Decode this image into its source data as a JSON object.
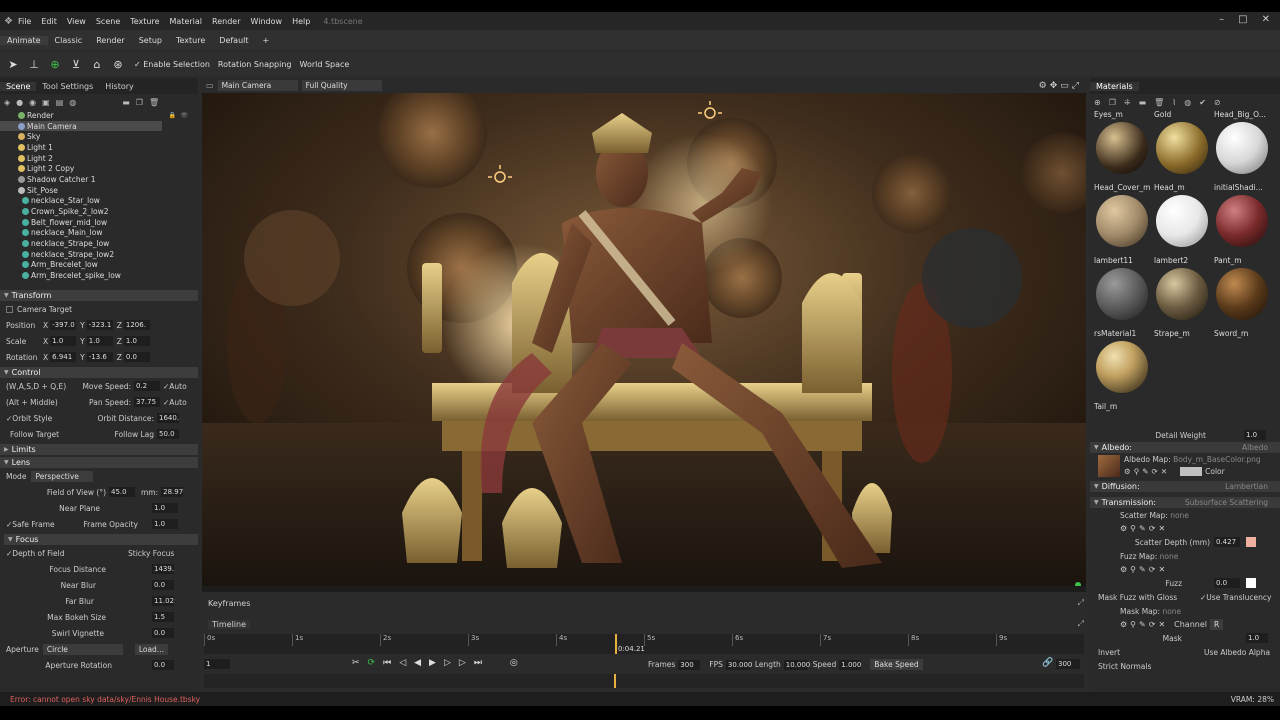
{
  "app": {
    "file_name": "4.tbscene"
  },
  "menu": [
    "File",
    "Edit",
    "View",
    "Scene",
    "Texture",
    "Material",
    "Render",
    "Window",
    "Help"
  ],
  "modes": [
    "Animate",
    "Classic",
    "Render",
    "Setup",
    "Texture",
    "Default",
    "+"
  ],
  "toolbar": {
    "enable_selection": "Enable Selection",
    "rotation_snapping": "Rotation Snapping",
    "world_space": "World Space"
  },
  "left_tabs": [
    "Scene",
    "Tool Settings",
    "History"
  ],
  "scene_tree": [
    "Render",
    "Main Camera",
    "Sky",
    "Light 1",
    "Light 2",
    "Light 2 Copy",
    "Shadow Catcher 1",
    "Sit_Pose",
    "necklace_Star_low",
    "Crown_Spike_2_low2",
    "Belt_flower_mid_low",
    "necklace_Main_low",
    "necklace_Strape_low",
    "necklace_Strape_low2",
    "Arm_Brecelet_low",
    "Arm_Brecelet_spike_low"
  ],
  "transform": {
    "title": "Transform",
    "camera_target": "Camera Target",
    "position": {
      "label": "Position",
      "x": "-397.0",
      "y": "-323.1",
      "z": "1206."
    },
    "scale": {
      "label": "Scale",
      "x": "1.0",
      "y": "1.0",
      "z": "1.0"
    },
    "rotation": {
      "label": "Rotation",
      "x": "6.941",
      "y": "-13.6",
      "z": "0.0"
    }
  },
  "control": {
    "title": "Control",
    "keys": "(W,A,S,D + Q,E)",
    "move_speed_label": "Move Speed:",
    "move_speed": "0.2",
    "auto": "Auto",
    "alt_middle": "(Alt + Middle)",
    "pan_speed_label": "Pan Speed:",
    "pan_speed": "37.75",
    "orbit_style": "Orbit Style",
    "orbit_distance_label": "Orbit Distance:",
    "orbit_distance": "1640.",
    "follow_target": "Follow Target",
    "follow_lag_label": "Follow Lag",
    "follow_lag": "50.0"
  },
  "limits": {
    "title": "Limits"
  },
  "lens": {
    "title": "Lens",
    "mode_label": "Mode",
    "mode": "Perspective",
    "fov_label": "Field of View (°)",
    "fov": "45.0",
    "mm_label": "mm:",
    "mm": "28.97",
    "near_plane_label": "Near Plane",
    "near_plane": "1.0",
    "safe_frame": "Safe Frame",
    "frame_opacity_label": "Frame Opacity",
    "frame_opacity": "1.0"
  },
  "focus": {
    "title": "Focus",
    "dof": "Depth of Field",
    "sticky": "Sticky Focus",
    "focus_distance_label": "Focus Distance",
    "focus_distance": "1439.",
    "near_blur_label": "Near Blur",
    "near_blur": "0.0",
    "far_blur_label": "Far Blur",
    "far_blur": "11.02",
    "max_bokeh_label": "Max Bokeh Size",
    "max_bokeh": "1.5",
    "swirl_label": "Swirl Vignette",
    "swirl": "0.0",
    "aperture_label": "Aperture",
    "aperture": "Circle",
    "load": "Load...",
    "aperture_rotation_label": "Aperture Rotation",
    "aperture_rotation": "0.0"
  },
  "viewport": {
    "camera": "Main Camera",
    "quality": "Full Quality"
  },
  "keyframes": {
    "label": "Keyframes"
  },
  "timeline": {
    "label": "Timeline",
    "ticks": [
      "0s",
      "1s",
      "2s",
      "3s",
      "4s",
      "5s",
      "6s",
      "7s",
      "8s",
      "9s"
    ],
    "current_time": "0:04.21",
    "current_frame": "1",
    "frames_label": "Frames",
    "frames": "300",
    "fps_label": "FPS",
    "fps": "30.000",
    "length_label": "Length",
    "length": "10.000",
    "speed_label": "Speed",
    "speed": "1.000",
    "bake_speed": "Bake Speed",
    "end_frame": "300"
  },
  "materials": {
    "title": "Materials",
    "top_labels": [
      "Eyes_m",
      "Gold",
      "Head_Big_O..."
    ],
    "items": [
      {
        "name": "Head_Cover_m",
        "color": "#3a2a1a"
      },
      {
        "name": "Head_m",
        "color": "#8a6a2a"
      },
      {
        "name": "initialShadi...",
        "color": "#d8d8d8"
      },
      {
        "name": "lambert11",
        "color": "#a08a6a"
      },
      {
        "name": "lambert2",
        "color": "#e8e8e8"
      },
      {
        "name": "Pant_m",
        "color": "#7a2a2a"
      },
      {
        "name": "rsMaterial1",
        "color": "#5a5a5a"
      },
      {
        "name": "Strape_m",
        "color": "#6a5a40"
      },
      {
        "name": "Sword_m",
        "color": "#5a3a1a"
      },
      {
        "name": "Tail_m",
        "color": "#c0a060"
      }
    ],
    "detail_weight_label": "Detail Weight",
    "detail_weight": "1.0",
    "albedo": "Albedo:",
    "albedo_type": "Albedo",
    "albedo_map_label": "Albedo Map:",
    "albedo_map": "Body_m_BaseColor.png",
    "color_label": "Color",
    "diffusion": "Diffusion:",
    "diffusion_type": "Lambertian",
    "transmission": "Transmission:",
    "transmission_type": "Subsurface Scattering",
    "scatter_map_label": "Scatter Map:",
    "none": "none",
    "scatter_depth_label": "Scatter Depth (mm)",
    "scatter_depth": "0.427",
    "fuzz_map_label": "Fuzz Map:",
    "fuzz_label": "Fuzz",
    "fuzz": "0.0",
    "mask_fuzz": "Mask Fuzz with Gloss",
    "use_translucency": "Use Translucency",
    "mask_map_label": "Mask Map:",
    "channel_label": "Channel",
    "channel": "R",
    "mask_label": "Mask",
    "mask": "1.0",
    "invert": "Invert",
    "use_albedo_alpha": "Use Albedo Alpha",
    "strict_normals": "Strict Normals"
  },
  "status": {
    "error": "Error: cannot open sky data/sky/Ennis House.tbsky",
    "vram": "VRAM: 28%"
  }
}
